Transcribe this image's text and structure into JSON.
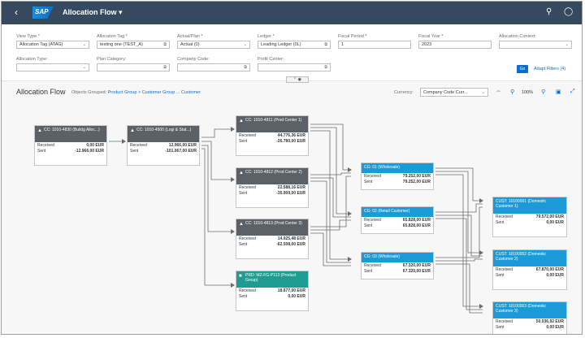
{
  "shell": {
    "title": "Allocation Flow",
    "logo": "SAP",
    "back_icon": "back-arrow-icon",
    "search_icon": "search-icon",
    "user_icon": "user-icon"
  },
  "filters": {
    "view_type": {
      "label": "View Type *",
      "value": "Allocation Tag (ATAG)"
    },
    "allocation_tag": {
      "label": "Allocation Tag *",
      "value": "testing one (TEST_A)"
    },
    "actual_plan": {
      "label": "Actual/Plan *",
      "value": "Actual (0)"
    },
    "ledger": {
      "label": "Ledger *",
      "value": "Leading Ledger (0L)"
    },
    "fiscal_period": {
      "label": "Fiscal Period *",
      "value": "1"
    },
    "fiscal_year": {
      "label": "Fiscal Year *",
      "value": "2023"
    },
    "allocation_context": {
      "label": "Allocation Context:",
      "value": ""
    },
    "allocation_type": {
      "label": "Allocation Type:",
      "value": ""
    },
    "plan_category": {
      "label": "Plan Category:",
      "value": ""
    },
    "company_code": {
      "label": "Company Code:",
      "value": ""
    },
    "profit_center": {
      "label": "Profit Center:",
      "value": ""
    },
    "go_label": "Go",
    "adapt_label": "Adapt Filters (4)"
  },
  "toolbar": {
    "title": "Allocation Flow",
    "grouped_label": "Objects Grouped:",
    "grouped_value": "Product Group > Customer Group ... Customer",
    "currency_label": "Currency:",
    "currency_value": "Company Code Curr...",
    "zoom": "100%"
  },
  "nodes": [
    {
      "id": "n1",
      "style": "gray",
      "icon": "cost-center-icon",
      "title": "CC: 1010-4830 (Buildg Alloc...)",
      "received_label": "Received",
      "received": "0,00 EUR",
      "sent_label": "Sent",
      "sent": "-12.966,00 EUR"
    },
    {
      "id": "n2",
      "style": "gray",
      "icon": "cost-center-icon",
      "title": "CC: 1010-4500 (Logi & Stat...)",
      "received_label": "Received",
      "received": "12.966,00 EUR",
      "sent_label": "Sent",
      "sent": "-101.067,00 EUR"
    },
    {
      "id": "n3",
      "style": "gray",
      "icon": "cost-center-icon",
      "title": "CC: 1010-4811 (Prod Center 1)",
      "received_label": "Received",
      "received": "44.776,36 EUR",
      "sent_label": "Sent",
      "sent": "-26.780,00 EUR"
    },
    {
      "id": "n4",
      "style": "gray",
      "icon": "cost-center-icon",
      "title": "CC: 1010-4812 (Prod Center 2)",
      "received_label": "Received",
      "received": "22.588,16 EUR",
      "sent_label": "Sent",
      "sent": "-35.909,00 EUR"
    },
    {
      "id": "n5",
      "style": "gray",
      "icon": "cost-center-icon",
      "title": "CC: 1010-4813 (Prod Center 3)",
      "received_label": "Received",
      "received": "14.925,48 EUR",
      "sent_label": "Sent",
      "sent": "-62.508,00 EUR"
    },
    {
      "id": "n6",
      "style": "teal",
      "icon": "product-icon",
      "title": "PRD: MZ-FG-P113 (Product Group)",
      "received_label": "Received",
      "received": "18.677,00 EUR",
      "sent_label": "Sent",
      "sent": "0,00 EUR"
    },
    {
      "id": "n7",
      "style": "blue",
      "icon": "",
      "title": "CG: 01 (Wholesale)",
      "received_label": "Received",
      "received": "79.252,00 EUR",
      "sent_label": "Sent",
      "sent": "79.252,00 EUR"
    },
    {
      "id": "n8",
      "style": "blue",
      "icon": "",
      "title": "CG: 02 (Retail Customer)",
      "received_label": "Received",
      "received": "65.828,00 EUR",
      "sent_label": "Sent",
      "sent": "65.828,00 EUR"
    },
    {
      "id": "n9",
      "style": "blue",
      "icon": "",
      "title": "CG: 03 (Wholesale)",
      "received_label": "Received",
      "received": "67.320,00 EUR",
      "sent_label": "Sent",
      "sent": "67.320,00 EUR"
    },
    {
      "id": "n10",
      "style": "blue",
      "icon": "",
      "title": "CUST: 10100001 (Domestic Customer 1)",
      "received_label": "Received",
      "received": "79.572,00 EUR",
      "sent_label": "Sent",
      "sent": "0,00 EUR"
    },
    {
      "id": "n11",
      "style": "blue",
      "icon": "",
      "title": "CUST: 10100002 (Domestic Customer 2)",
      "received_label": "Received",
      "received": "67.870,00 EUR",
      "sent_label": "Sent",
      "sent": "0,00 EUR"
    },
    {
      "id": "n12",
      "style": "blue",
      "icon": "",
      "title": "CUST: 10100003 (Domestic Customer 3)",
      "received_label": "Received",
      "received": "50.036,92 EUR",
      "sent_label": "Sent",
      "sent": "0,00 EUR"
    }
  ]
}
